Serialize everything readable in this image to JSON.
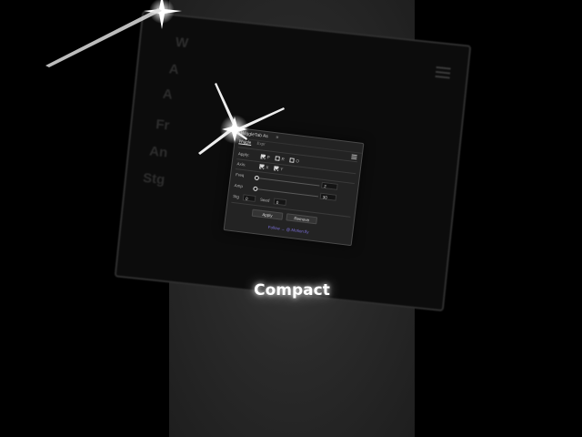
{
  "background_panel": {
    "labels": [
      "W",
      "A",
      "A",
      "Fr",
      "An",
      "Stg"
    ]
  },
  "panel": {
    "title": "WiggleTab As",
    "title_menu": "≡",
    "tabs": [
      "Wiggle",
      "Expr"
    ],
    "apply_label": "Apply:",
    "apply_options": [
      {
        "label": "P",
        "checked": true
      },
      {
        "label": "R",
        "checked": false
      },
      {
        "label": "O",
        "checked": false
      }
    ],
    "axis_label": "Axis:",
    "axis_options": [
      {
        "label": "X",
        "checked": true
      },
      {
        "label": "Y",
        "checked": true
      }
    ],
    "freq_label": "Freq",
    "freq_value": "2",
    "amp_label": "Amp",
    "amp_value": "30",
    "stg_label": "Stg",
    "stg_value": "0",
    "seed_label": "Seed",
    "seed_value": "0",
    "apply_button": "Apply",
    "remove_button": "Remove",
    "footer": "Follow → @.Motion.fly"
  },
  "caption": "Compact",
  "colors": {
    "accent_link": "#7b6fd6",
    "panel_bg": "#232323",
    "caption": "#ffffff"
  }
}
